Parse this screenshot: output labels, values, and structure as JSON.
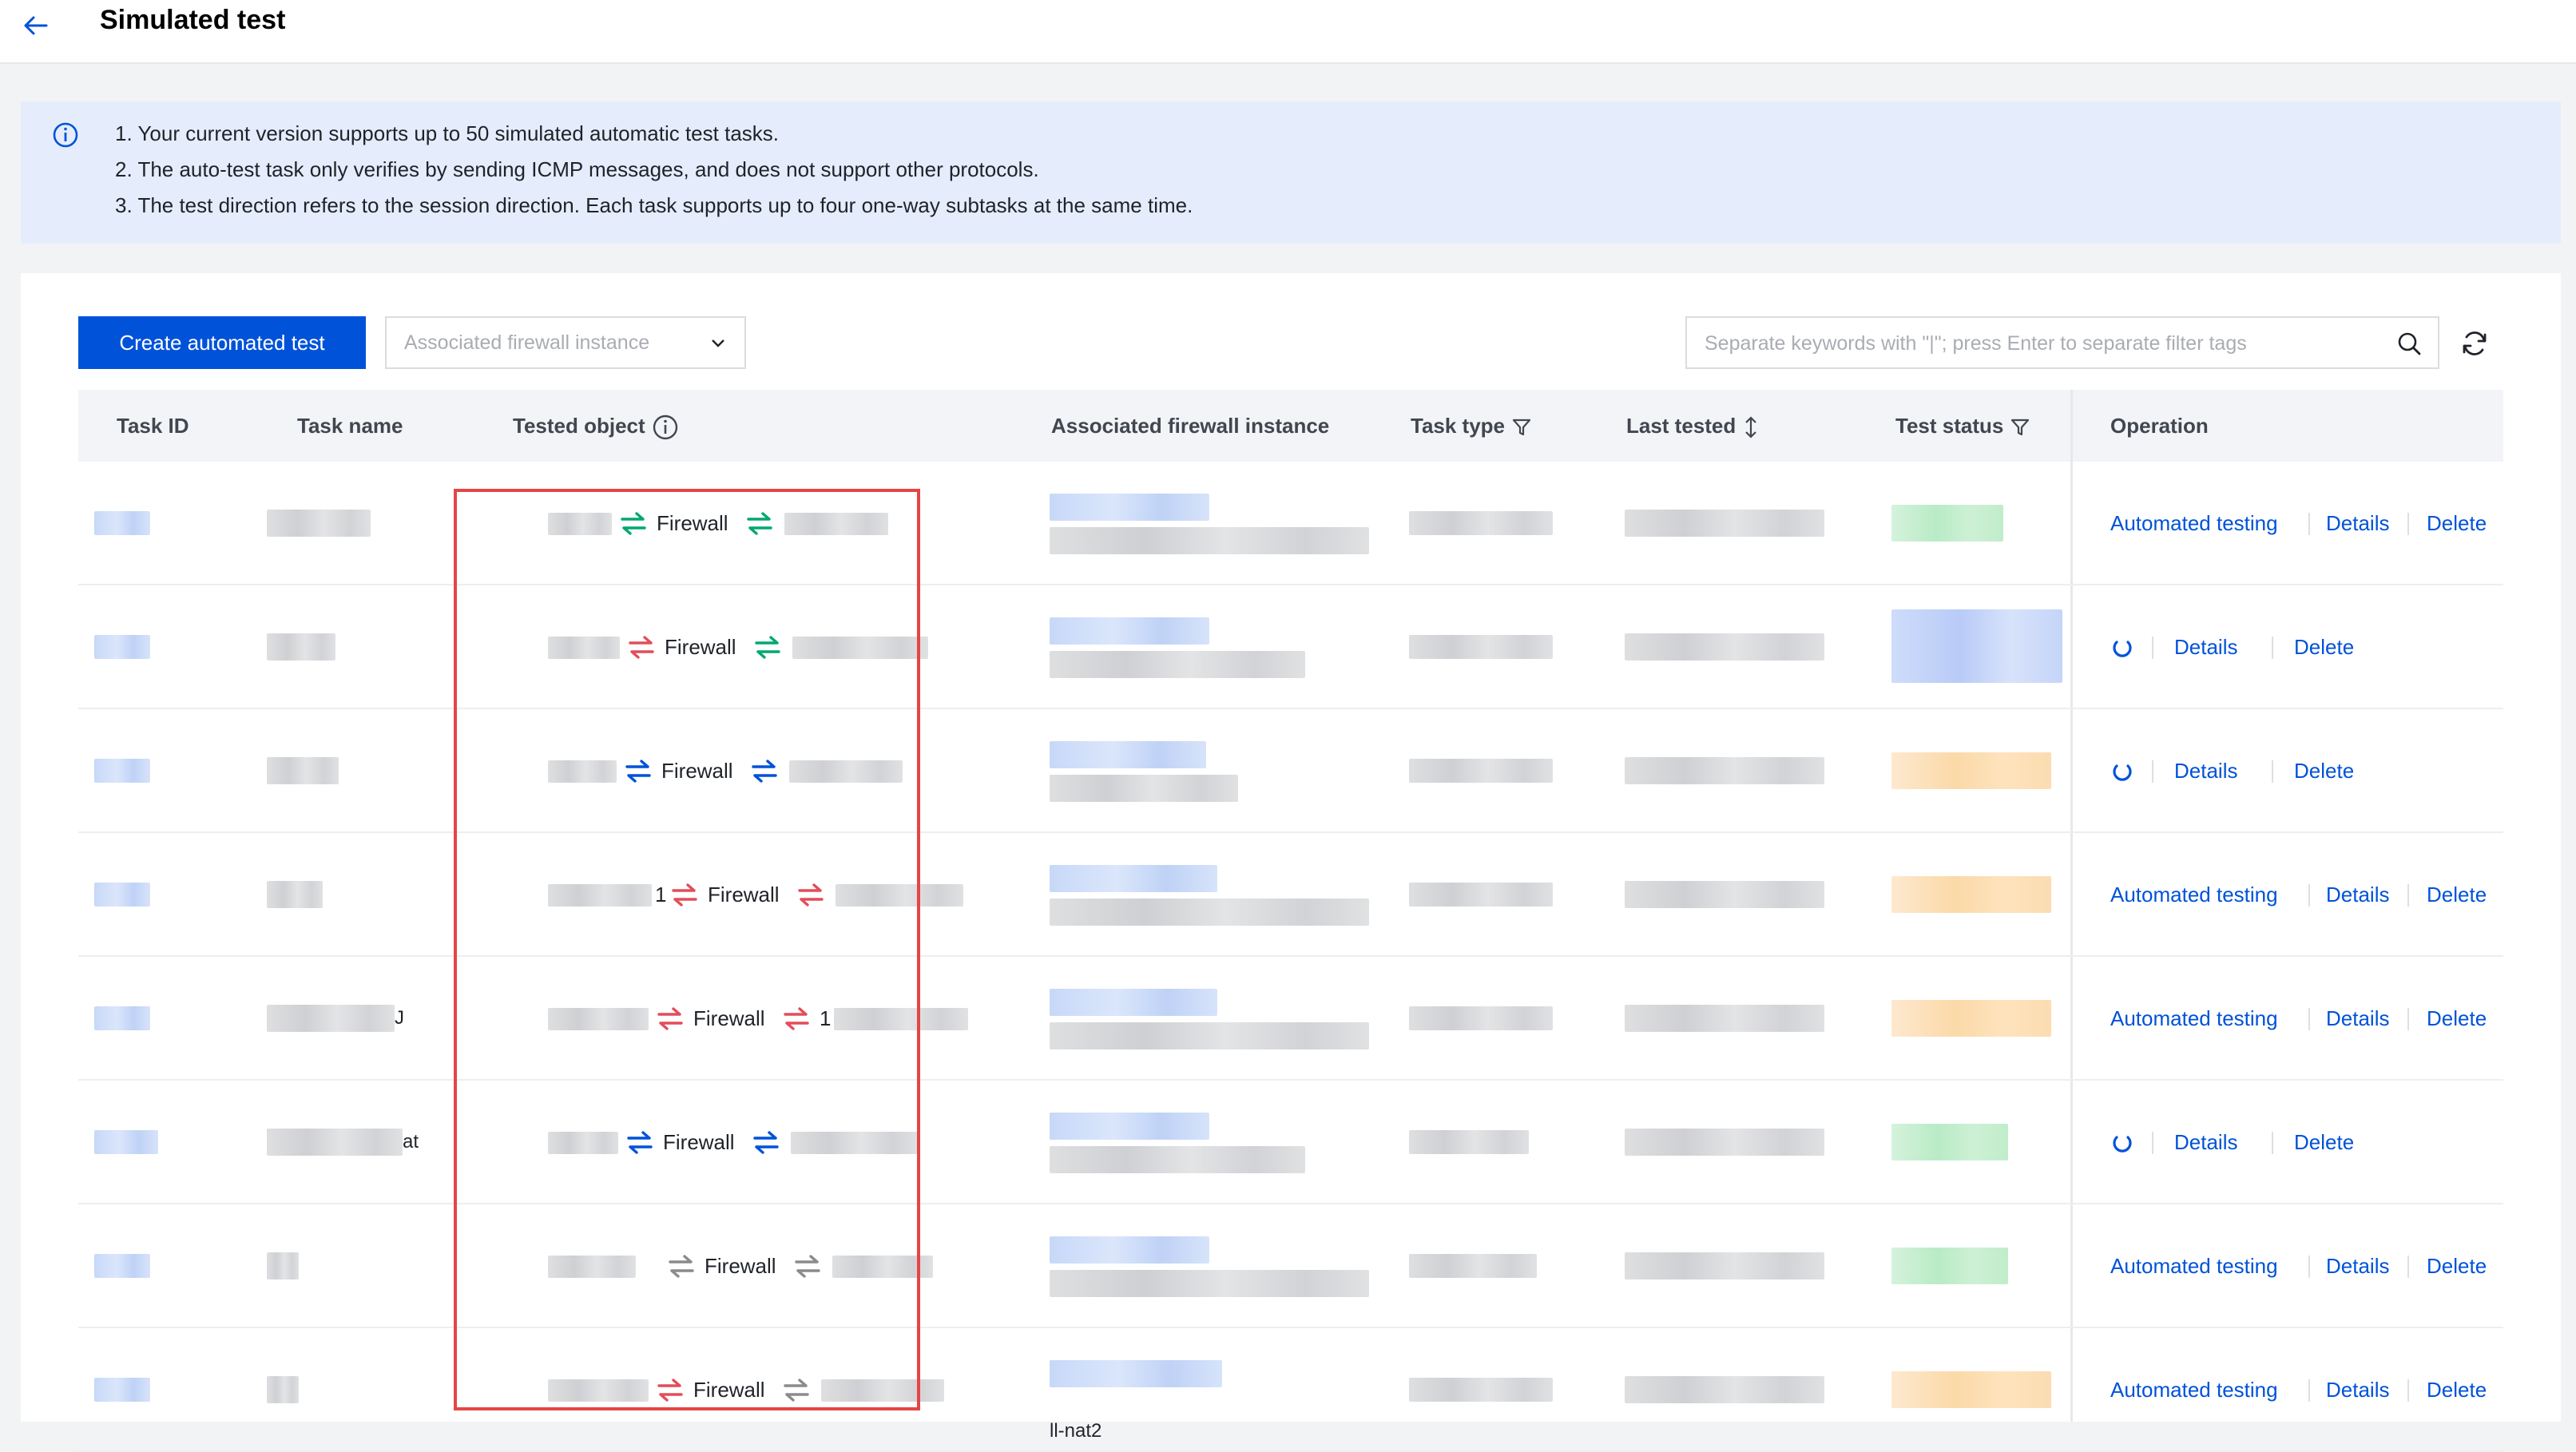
{
  "header": {
    "title": "Simulated test"
  },
  "notice": {
    "lines": [
      "1. Your current version supports up to 50 simulated automatic test tasks.",
      "2. The auto-test task only verifies by sending ICMP messages, and does not support other protocols.",
      "3. The test direction refers to the session direction. Each task supports up to four one-way subtasks at the same time."
    ]
  },
  "toolbar": {
    "create_label": "Create automated test",
    "firewall_select_placeholder": "Associated firewall instance",
    "search_placeholder": "Separate keywords with \"|\"; press Enter to separate filter tags"
  },
  "table": {
    "columns": [
      "Task ID",
      "Task name",
      "Tested object",
      "Associated firewall instance",
      "Task type",
      "Last tested",
      "Test status",
      "Operation"
    ],
    "firewall_label": "Firewall",
    "rows": [
      {
        "left_arrow": "green",
        "right_arrow": "green",
        "status": "green",
        "running": false,
        "extra_left": "",
        "extra_right": "",
        "name_suffix": "",
        "fw_suffix": ""
      },
      {
        "left_arrow": "red",
        "right_arrow": "green",
        "status": "blue",
        "running": true,
        "extra_left": "",
        "extra_right": "",
        "name_suffix": "",
        "fw_suffix": ""
      },
      {
        "left_arrow": "blue",
        "right_arrow": "blue",
        "status": "orange",
        "running": true,
        "extra_left": "",
        "extra_right": "",
        "name_suffix": "",
        "fw_suffix": ""
      },
      {
        "left_arrow": "red",
        "right_arrow": "red",
        "status": "orange",
        "running": false,
        "extra_left": "1",
        "extra_right": "",
        "name_suffix": "",
        "fw_suffix": ""
      },
      {
        "left_arrow": "red",
        "right_arrow": "red",
        "status": "orange",
        "running": false,
        "extra_left": "",
        "extra_right": "1",
        "name_suffix": "J",
        "fw_suffix": ""
      },
      {
        "left_arrow": "blue",
        "right_arrow": "blue",
        "status": "green",
        "running": true,
        "extra_left": "",
        "extra_right": "",
        "name_suffix": "at",
        "fw_suffix": ""
      },
      {
        "left_arrow": "gray",
        "right_arrow": "gray",
        "status": "green",
        "running": false,
        "extra_left": "",
        "extra_right": "",
        "name_suffix": "",
        "fw_suffix": ""
      },
      {
        "left_arrow": "red",
        "right_arrow": "gray",
        "status": "orange",
        "running": false,
        "extra_left": "",
        "extra_right": "",
        "name_suffix": "",
        "fw_suffix": "ll-nat2"
      }
    ]
  },
  "operations": {
    "automated_testing": "Automated testing",
    "details": "Details",
    "delete": "Delete"
  },
  "colors": {
    "primary": "#0052d9",
    "arrow_green": "#00a870",
    "arrow_red": "#e34d59",
    "arrow_blue": "#0052d9",
    "arrow_gray": "#8b8b8b",
    "highlight": "#e54545"
  }
}
